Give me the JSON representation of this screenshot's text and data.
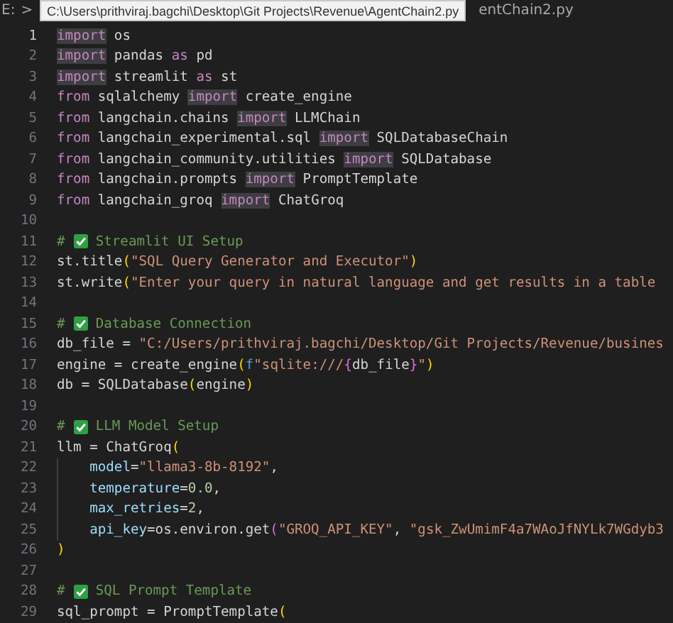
{
  "breadcrumb": {
    "drive": "E:",
    "separator": ">",
    "tail": "entChain2.py"
  },
  "tooltip": {
    "text": "C:\\Users\\prithviraj.bagchi\\Desktop\\Git Projects\\Revenue\\AgentChain2.py"
  },
  "lines": [
    {
      "number": "1",
      "active": true,
      "tokens": [
        {
          "kind": "kw_match",
          "text": "import"
        },
        {
          "kind": "text",
          "text": " os"
        }
      ]
    },
    {
      "number": "2",
      "active": false,
      "tokens": [
        {
          "kind": "kw_match",
          "text": "import"
        },
        {
          "kind": "text",
          "text": " pandas "
        },
        {
          "kind": "kw",
          "text": "as"
        },
        {
          "kind": "text",
          "text": " pd"
        }
      ]
    },
    {
      "number": "3",
      "active": false,
      "tokens": [
        {
          "kind": "kw_match",
          "text": "import"
        },
        {
          "kind": "text",
          "text": " streamlit "
        },
        {
          "kind": "kw",
          "text": "as"
        },
        {
          "kind": "text",
          "text": " st"
        }
      ]
    },
    {
      "number": "4",
      "active": false,
      "tokens": [
        {
          "kind": "kw",
          "text": "from"
        },
        {
          "kind": "text",
          "text": " sqlalchemy "
        },
        {
          "kind": "kw_match",
          "text": "import"
        },
        {
          "kind": "text",
          "text": " create_engine"
        }
      ]
    },
    {
      "number": "5",
      "active": false,
      "tokens": [
        {
          "kind": "kw",
          "text": "from"
        },
        {
          "kind": "text",
          "text": " langchain.chains "
        },
        {
          "kind": "kw_match",
          "text": "import"
        },
        {
          "kind": "text",
          "text": " LLMChain"
        }
      ]
    },
    {
      "number": "6",
      "active": false,
      "tokens": [
        {
          "kind": "kw",
          "text": "from"
        },
        {
          "kind": "text",
          "text": " langchain_experimental.sql "
        },
        {
          "kind": "kw_match",
          "text": "import"
        },
        {
          "kind": "text",
          "text": " SQLDatabaseChain"
        }
      ]
    },
    {
      "number": "7",
      "active": false,
      "tokens": [
        {
          "kind": "kw",
          "text": "from"
        },
        {
          "kind": "text",
          "text": " langchain_community.utilities "
        },
        {
          "kind": "kw_match",
          "text": "import"
        },
        {
          "kind": "text",
          "text": " SQLDatabase"
        }
      ]
    },
    {
      "number": "8",
      "active": false,
      "tokens": [
        {
          "kind": "kw",
          "text": "from"
        },
        {
          "kind": "text",
          "text": " langchain.prompts "
        },
        {
          "kind": "kw_match",
          "text": "import"
        },
        {
          "kind": "text",
          "text": " PromptTemplate"
        }
      ]
    },
    {
      "number": "9",
      "active": false,
      "tokens": [
        {
          "kind": "kw",
          "text": "from"
        },
        {
          "kind": "text",
          "text": " langchain_groq "
        },
        {
          "kind": "kw_match",
          "text": "import"
        },
        {
          "kind": "text",
          "text": " ChatGroq"
        }
      ]
    },
    {
      "number": "10",
      "active": false
    },
    {
      "number": "11",
      "active": false,
      "tokens": [
        {
          "kind": "comment",
          "text": "# "
        },
        {
          "kind": "check"
        },
        {
          "kind": "comment",
          "text": " Streamlit UI Setup"
        }
      ]
    },
    {
      "number": "12",
      "active": false,
      "tokens": [
        {
          "kind": "text",
          "text": "st.title"
        },
        {
          "kind": "brace",
          "text": "("
        },
        {
          "kind": "str",
          "text": "\"SQL Query Generator and Executor\""
        },
        {
          "kind": "brace",
          "text": ")"
        }
      ]
    },
    {
      "number": "13",
      "active": false,
      "tokens": [
        {
          "kind": "text",
          "text": "st.write"
        },
        {
          "kind": "brace",
          "text": "("
        },
        {
          "kind": "str",
          "text": "\"Enter your query in natural language and get results in a table"
        }
      ]
    },
    {
      "number": "14",
      "active": false
    },
    {
      "number": "15",
      "active": false,
      "tokens": [
        {
          "kind": "comment",
          "text": "# "
        },
        {
          "kind": "check"
        },
        {
          "kind": "comment",
          "text": " Database Connection"
        }
      ]
    },
    {
      "number": "16",
      "active": false,
      "tokens": [
        {
          "kind": "text",
          "text": "db_file = "
        },
        {
          "kind": "str",
          "text": "\"C:/Users/prithviraj.bagchi/Desktop/Git Projects/Revenue/busines"
        }
      ]
    },
    {
      "number": "17",
      "active": false,
      "tokens": [
        {
          "kind": "text",
          "text": "engine = create_engine"
        },
        {
          "kind": "brace",
          "text": "("
        },
        {
          "kind": "fprefix",
          "text": "f"
        },
        {
          "kind": "str",
          "text": "\"sqlite:///"
        },
        {
          "kind": "brace2",
          "text": "{"
        },
        {
          "kind": "text",
          "text": "db_file"
        },
        {
          "kind": "brace2",
          "text": "}"
        },
        {
          "kind": "str",
          "text": "\""
        },
        {
          "kind": "brace",
          "text": ")"
        }
      ]
    },
    {
      "number": "18",
      "active": false,
      "tokens": [
        {
          "kind": "text",
          "text": "db = SQLDatabase"
        },
        {
          "kind": "brace",
          "text": "("
        },
        {
          "kind": "text",
          "text": "engine"
        },
        {
          "kind": "brace",
          "text": ")"
        }
      ]
    },
    {
      "number": "19",
      "active": false
    },
    {
      "number": "20",
      "active": false,
      "tokens": [
        {
          "kind": "comment",
          "text": "# "
        },
        {
          "kind": "check"
        },
        {
          "kind": "comment",
          "text": " LLM Model Setup"
        }
      ]
    },
    {
      "number": "21",
      "active": false,
      "tokens": [
        {
          "kind": "text",
          "text": "llm = ChatGroq"
        },
        {
          "kind": "brace",
          "text": "("
        }
      ]
    },
    {
      "number": "22",
      "active": false,
      "tokens": [
        {
          "kind": "indent"
        },
        {
          "kind": "param",
          "text": "model"
        },
        {
          "kind": "text",
          "text": "="
        },
        {
          "kind": "str",
          "text": "\"llama3-8b-8192\""
        },
        {
          "kind": "text",
          "text": ","
        }
      ]
    },
    {
      "number": "23",
      "active": false,
      "tokens": [
        {
          "kind": "indent"
        },
        {
          "kind": "param",
          "text": "temperature"
        },
        {
          "kind": "text",
          "text": "="
        },
        {
          "kind": "num",
          "text": "0.0"
        },
        {
          "kind": "text",
          "text": ","
        }
      ]
    },
    {
      "number": "24",
      "active": false,
      "tokens": [
        {
          "kind": "indent"
        },
        {
          "kind": "param",
          "text": "max_retries"
        },
        {
          "kind": "text",
          "text": "="
        },
        {
          "kind": "num",
          "text": "2"
        },
        {
          "kind": "text",
          "text": ","
        }
      ]
    },
    {
      "number": "25",
      "active": false,
      "tokens": [
        {
          "kind": "indent"
        },
        {
          "kind": "param",
          "text": "api_key"
        },
        {
          "kind": "text",
          "text": "=os.environ.get"
        },
        {
          "kind": "brace2",
          "text": "("
        },
        {
          "kind": "str",
          "text": "\"GROQ_API_KEY\""
        },
        {
          "kind": "text",
          "text": ", "
        },
        {
          "kind": "str",
          "text": "\"gsk_ZwUmimF4a7WAoJfNYLk7WGdyb3"
        }
      ]
    },
    {
      "number": "26",
      "active": false,
      "tokens": [
        {
          "kind": "brace",
          "text": ")"
        }
      ]
    },
    {
      "number": "27",
      "active": false
    },
    {
      "number": "28",
      "active": false,
      "tokens": [
        {
          "kind": "comment",
          "text": "# "
        },
        {
          "kind": "check"
        },
        {
          "kind": "comment",
          "text": " SQL Prompt Template"
        }
      ]
    },
    {
      "number": "29",
      "active": false,
      "tokens": [
        {
          "kind": "text",
          "text": "sql_prompt = PromptTemplate"
        },
        {
          "kind": "brace",
          "text": "("
        }
      ]
    }
  ]
}
